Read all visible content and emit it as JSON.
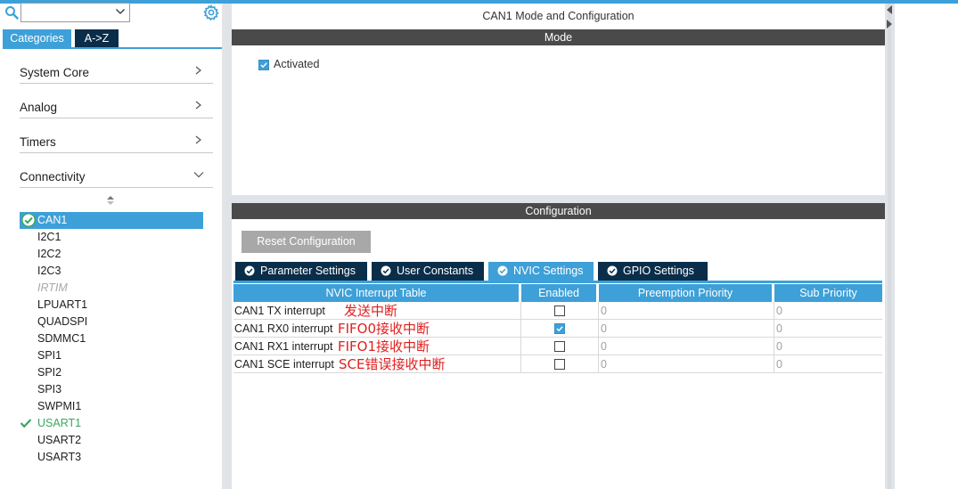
{
  "colors": {
    "accent": "#3ea0d8",
    "dark_tab": "#0a2e4a",
    "section_bar": "#4a4a4a",
    "ok_green": "#3ea55e",
    "annotation_red": "#e02020"
  },
  "left": {
    "search": {
      "value": "",
      "icon": "search-icon",
      "dropdown_icon": "chevron-down-icon"
    },
    "settings_icon": "gear-icon",
    "tabs": [
      {
        "label": "Categories",
        "active": true
      },
      {
        "label": "A->Z",
        "active": false
      }
    ],
    "categories": [
      {
        "label": "System Core",
        "expanded": false
      },
      {
        "label": "Analog",
        "expanded": false
      },
      {
        "label": "Timers",
        "expanded": false
      },
      {
        "label": "Connectivity",
        "expanded": true
      }
    ],
    "peripherals": [
      {
        "label": "CAN1",
        "state": "selected"
      },
      {
        "label": "I2C1",
        "state": "normal"
      },
      {
        "label": "I2C2",
        "state": "normal"
      },
      {
        "label": "I2C3",
        "state": "normal"
      },
      {
        "label": "IRTIM",
        "state": "disabled"
      },
      {
        "label": "LPUART1",
        "state": "normal"
      },
      {
        "label": "QUADSPI",
        "state": "normal"
      },
      {
        "label": "SDMMC1",
        "state": "normal"
      },
      {
        "label": "SPI1",
        "state": "normal"
      },
      {
        "label": "SPI2",
        "state": "normal"
      },
      {
        "label": "SPI3",
        "state": "normal"
      },
      {
        "label": "SWPMI1",
        "state": "normal"
      },
      {
        "label": "USART1",
        "state": "configured"
      },
      {
        "label": "USART2",
        "state": "normal"
      },
      {
        "label": "USART3",
        "state": "normal"
      }
    ]
  },
  "main": {
    "title": "CAN1 Mode and Configuration",
    "mode": {
      "header": "Mode",
      "activated_label": "Activated",
      "activated": true
    },
    "configuration": {
      "header": "Configuration",
      "reset_label": "Reset Configuration",
      "tabs": [
        {
          "label": "Parameter Settings",
          "active": false
        },
        {
          "label": "User Constants",
          "active": false
        },
        {
          "label": "NVIC Settings",
          "active": true
        },
        {
          "label": "GPIO Settings",
          "active": false
        }
      ],
      "table": {
        "headers": [
          "NVIC Interrupt Table",
          "Enabled",
          "Preemption Priority",
          "Sub Priority"
        ],
        "rows": [
          {
            "name": "CAN1 TX interrupt",
            "enabled": false,
            "preemption": "0",
            "sub": "0",
            "note": "发送中断"
          },
          {
            "name": "CAN1 RX0 interrupt",
            "enabled": true,
            "preemption": "0",
            "sub": "0",
            "note": "FIFO0接收中断"
          },
          {
            "name": "CAN1 RX1 interrupt",
            "enabled": false,
            "preemption": "0",
            "sub": "0",
            "note": "FIFO1接收中断"
          },
          {
            "name": "CAN1 SCE interrupt",
            "enabled": false,
            "preemption": "0",
            "sub": "0",
            "note": "SCE错误接收中断"
          }
        ]
      }
    }
  }
}
